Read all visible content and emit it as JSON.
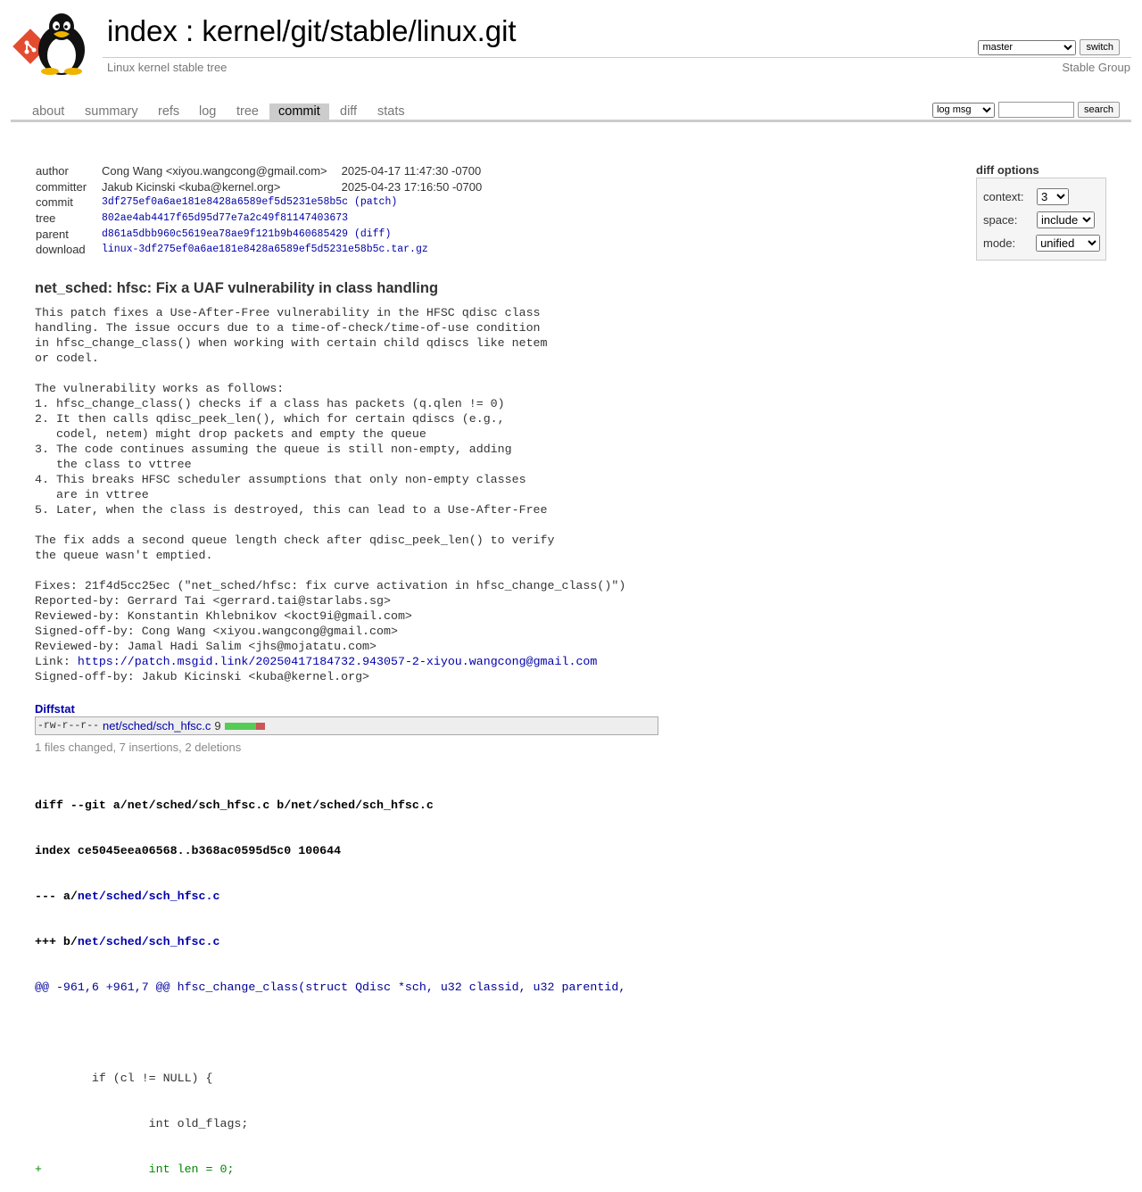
{
  "header": {
    "index_label": "index",
    "separator": " : ",
    "repo_path": "kernel/git/stable/linux.git",
    "description": "Linux kernel stable tree",
    "owner": "Stable Group",
    "branch": {
      "selected": "master",
      "button": "switch"
    }
  },
  "tabs": [
    {
      "label": "about",
      "active": false
    },
    {
      "label": "summary",
      "active": false
    },
    {
      "label": "refs",
      "active": false
    },
    {
      "label": "log",
      "active": false
    },
    {
      "label": "tree",
      "active": false
    },
    {
      "label": "commit",
      "active": true
    },
    {
      "label": "diff",
      "active": false
    },
    {
      "label": "stats",
      "active": false
    }
  ],
  "search": {
    "mode": "log msg",
    "value": "",
    "button": "search"
  },
  "commit": {
    "author_label": "author",
    "author": "Cong Wang <xiyou.wangcong@gmail.com>",
    "author_date": "2025-04-17 11:47:30 -0700",
    "committer_label": "committer",
    "committer": "Jakub Kicinski <kuba@kernel.org>",
    "committer_date": "2025-04-23 17:16:50 -0700",
    "commit_label": "commit",
    "commit_sha": "3df275ef0a6ae181e8428a6589ef5d5231e58b5c",
    "patch_link": "(patch)",
    "tree_label": "tree",
    "tree_sha": "802ae4ab4417f65d95d77e7a2c49f81147403673",
    "parent_label": "parent",
    "parent_sha": "d861a5dbb960c5619ea78ae9f121b9b460685429",
    "diff_link": "(diff)",
    "download_label": "download",
    "download": "linux-3df275ef0a6ae181e8428a6589ef5d5231e58b5c.tar.gz"
  },
  "diff_options": {
    "title": "diff options",
    "context_label": "context:",
    "context": "3",
    "space_label": "space:",
    "space": "include",
    "mode_label": "mode:",
    "mode": "unified"
  },
  "message": {
    "subject": "net_sched: hfsc: Fix a UAF vulnerability in class handling",
    "body_before_link": "This patch fixes a Use-After-Free vulnerability in the HFSC qdisc class\nhandling. The issue occurs due to a time-of-check/time-of-use condition\nin hfsc_change_class() when working with certain child qdiscs like netem\nor codel.\n\nThe vulnerability works as follows:\n1. hfsc_change_class() checks if a class has packets (q.qlen != 0)\n2. It then calls qdisc_peek_len(), which for certain qdiscs (e.g.,\n   codel, netem) might drop packets and empty the queue\n3. The code continues assuming the queue is still non-empty, adding\n   the class to vttree\n4. This breaks HFSC scheduler assumptions that only non-empty classes\n   are in vttree\n5. Later, when the class is destroyed, this can lead to a Use-After-Free\n\nThe fix adds a second queue length check after qdisc_peek_len() to verify\nthe queue wasn't emptied.\n\nFixes: 21f4d5cc25ec (\"net_sched/hfsc: fix curve activation in hfsc_change_class()\")\nReported-by: Gerrard Tai <gerrard.tai@starlabs.sg>\nReviewed-by: Konstantin Khlebnikov <koct9i@gmail.com>\nSigned-off-by: Cong Wang <xiyou.wangcong@gmail.com>\nReviewed-by: Jamal Hadi Salim <jhs@mojatatu.com>\nLink: ",
    "link": "https://patch.msgid.link/20250417184732.943057-2-xiyou.wangcong@gmail.com",
    "body_after_link": "\nSigned-off-by: Jakub Kicinski <kuba@kernel.org>"
  },
  "diffstat": {
    "title": "Diffstat",
    "mode": "-rw-r--r--",
    "file": "net/sched/sch_hfsc.c",
    "count": "9",
    "insertions_fraction": 0.78,
    "summary": "1 files changed, 7 insertions, 2 deletions"
  },
  "diff": {
    "line1": "diff --git a/net/sched/sch_hfsc.c b/net/sched/sch_hfsc.c",
    "line2": "index ce5045eea06568..b368ac0595d5c0 100644",
    "minus_prefix": "--- a/",
    "plus_prefix": "+++ b/",
    "file": "net/sched/sch_hfsc.c",
    "hunk": "@@ -961,6 +961,7 @@ hfsc_change_class(struct Qdisc *sch, u32 classid, u32 parentid,",
    "ctx1": "",
    "ctx2": "        if (cl != NULL) {",
    "ctx3": "                int old_flags;",
    "add1": "+               int len = 0;"
  }
}
